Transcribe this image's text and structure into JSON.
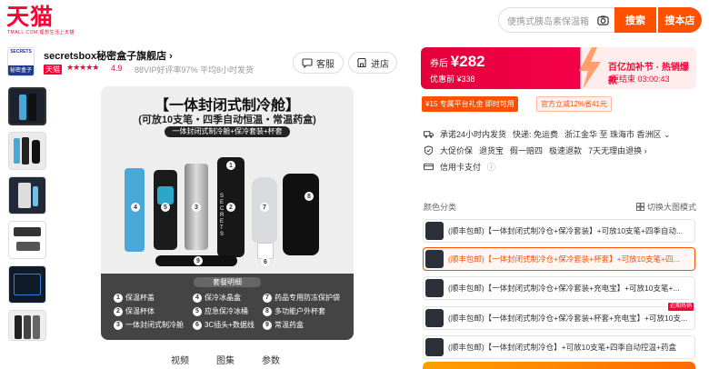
{
  "header": {
    "logo_text": "天猫",
    "logo_sub": "TMALL.COM 理想生活上天猫",
    "search_placeholder": "便携式胰岛素保温箱",
    "search_button": "搜索",
    "store_search_button": "搜本店"
  },
  "shop": {
    "logo_text": "SECRETS",
    "logo_sub": "秘密盒子",
    "name": "secretsbox秘密盒子旗舰店 ›",
    "tmall_tag": "天猫",
    "stars": "★★★★★",
    "score": "4.9",
    "meta": "88VIP好评率97%   平均8小时发货",
    "customer_service": "客服",
    "enter_store": "进店"
  },
  "main_image": {
    "title": "【一体封闭式制冷舱】",
    "subtitle": "(可放10支笔・四季自动恒温・常温药盒)",
    "band": "一体封闭式制冷舱+保冷套装+杯套",
    "panel_title": "套餐明细",
    "items": [
      "1 保温杯盖",
      "2 保温杯体",
      "3 一体封闭式制冷舱",
      "4 保冷冰晶盒",
      "5 应急保冷冰桶",
      "6 3C插头+数据线",
      "7 药品专用防冻保护袋",
      "8 多功能户外杯套",
      "9 常温药盒"
    ],
    "item_nums": [
      "1",
      "2",
      "3",
      "4",
      "5",
      "6",
      "7",
      "8",
      "9"
    ],
    "item_labels": [
      "保温杯盖",
      "保温杯体",
      "一体封闭式制冷舱",
      "保冷冰晶盒",
      "应急保冷冰桶",
      "3C插头+数据线",
      "药品专用防冻保护袋",
      "多功能户外杯套",
      "常温药盒"
    ],
    "product_label": "SECRETS"
  },
  "gallery_tabs": [
    "视频",
    "图集",
    "参数"
  ],
  "promo": {
    "coupon_label": "券后",
    "price": "¥282",
    "original": "优惠前 ¥338",
    "right_title": "百亿加补节 · 热销爆款",
    "countdown": "距结束 03:00:43"
  },
  "coupons": {
    "c1": "¥15  专属平台礼金 即时可用",
    "c2": "官方立减12%省41元"
  },
  "services": {
    "line1": [
      "承诺24小时内发货",
      "快递: 免运费",
      "浙江金华 至 珠海市 香洲区 ⌄"
    ],
    "line2": [
      "大促价保",
      "退货宝",
      "假一赔四",
      "极速退款",
      "7天无理由退换 ›"
    ],
    "line3": [
      "信用卡支付",
      "ⓘ"
    ]
  },
  "sku": {
    "label": "颜色分类",
    "toggle": "切换大图模式",
    "options": [
      "(顺丰包邮)【一体封闭式制冷仓+保冷套装】+可放10支笔+四季自动...",
      "(顺丰包邮)【一体封闭式制冷仓+保冷套装+杯套】+可放10支笔+四...",
      "(顺丰包邮)【一体封闭式制冷仓+保冷套装+充电宝】+可放10支笔+...",
      "(顺丰包邮)【一体封闭式制冷仓+保冷套装+杯套+充电宝】+可放10支...",
      "(顺丰包邮)【一体封闭式制冷仓】+可放10支笔+四季自动控温+药盒"
    ],
    "new_tag": "近期热销"
  },
  "colors": {
    "tmall_red": "#ff0036",
    "accent_orange": "#ff5000"
  }
}
